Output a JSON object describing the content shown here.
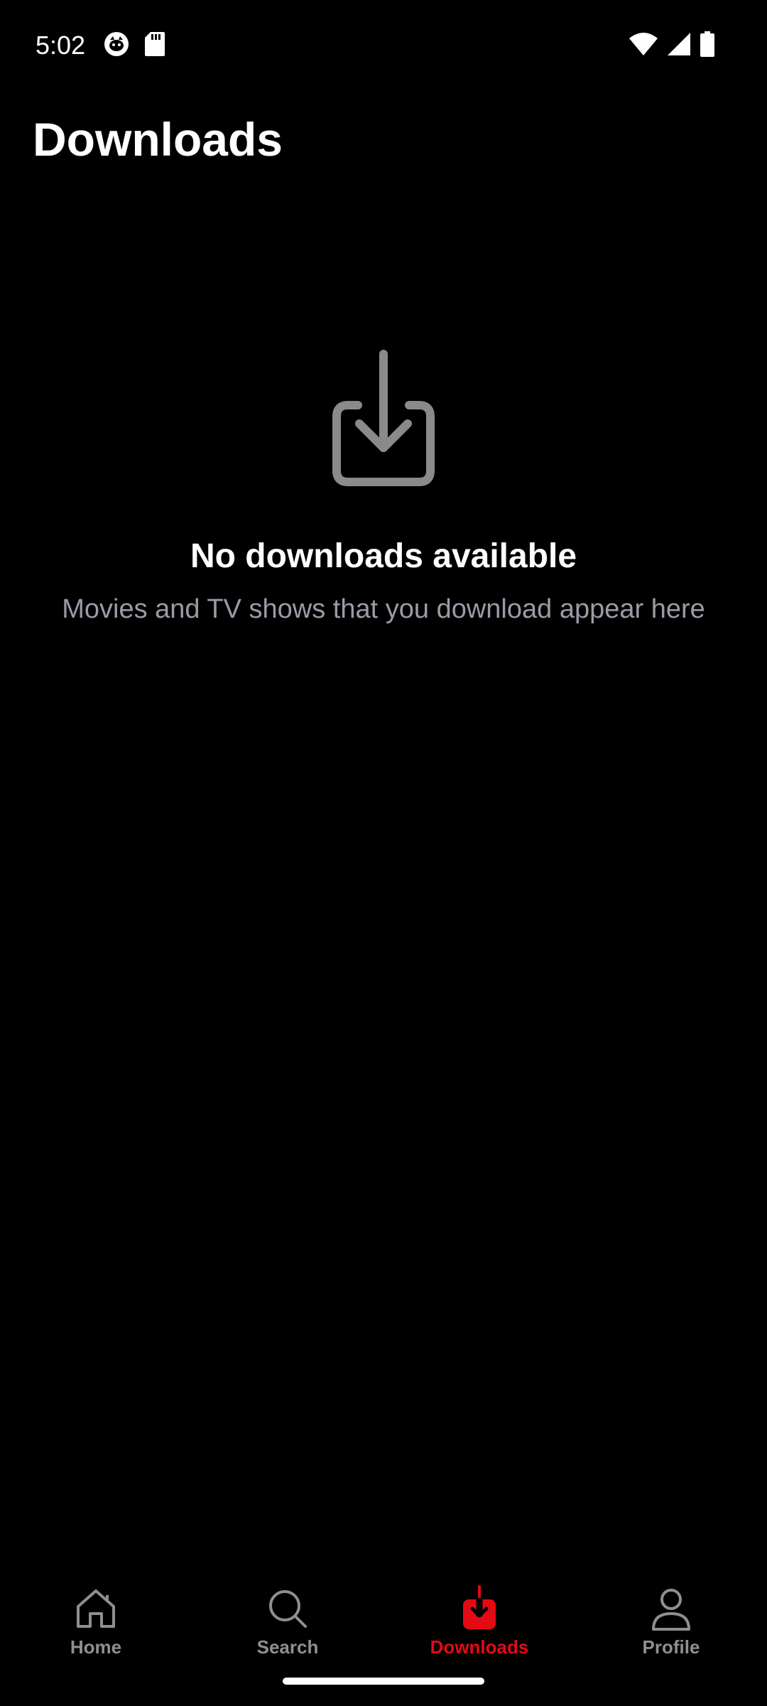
{
  "status_bar": {
    "time": "5:02",
    "left_icons": [
      "cat-notification-icon",
      "sd-card-icon"
    ],
    "right_icons": [
      "wifi-icon",
      "cellular-signal-icon",
      "battery-icon"
    ]
  },
  "header": {
    "title": "Downloads"
  },
  "empty_state": {
    "icon": "download-tray-icon",
    "title": "No downloads available",
    "subtitle": "Movies and TV shows that you download appear here"
  },
  "bottom_nav": {
    "items": [
      {
        "label": "Home",
        "icon": "home-icon",
        "active": false
      },
      {
        "label": "Search",
        "icon": "search-icon",
        "active": false
      },
      {
        "label": "Downloads",
        "icon": "download-icon",
        "active": true
      },
      {
        "label": "Profile",
        "icon": "profile-icon",
        "active": false
      }
    ]
  },
  "colors": {
    "background": "#000000",
    "accent": "#e50914",
    "inactive": "#8e8e93",
    "subtitle": "#9a9ba6",
    "icon_gray": "#8a8a8a"
  }
}
